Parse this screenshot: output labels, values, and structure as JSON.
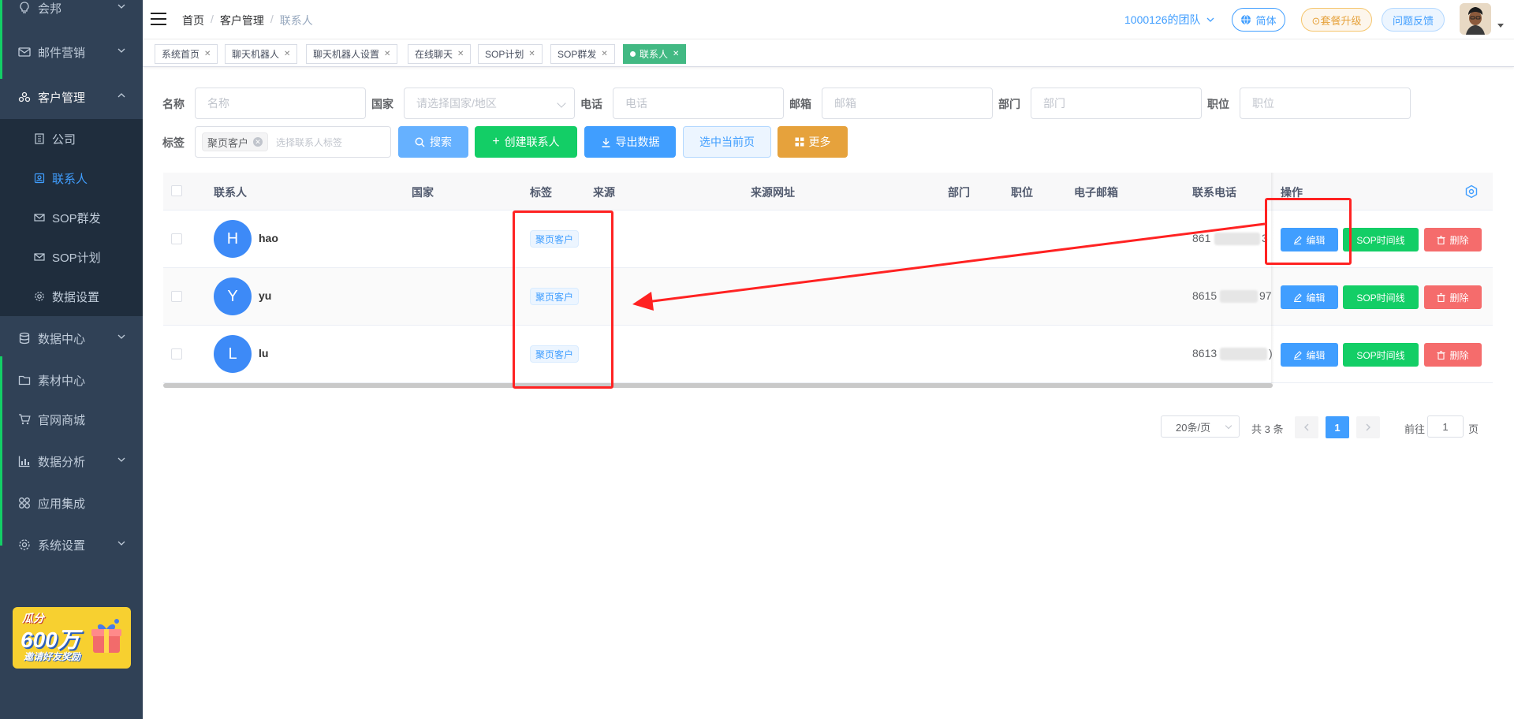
{
  "sidebar": {
    "top_item": "会邦",
    "items": [
      {
        "label": "邮件营销"
      },
      {
        "label": "客户管理"
      },
      {
        "label": "数据中心"
      },
      {
        "label": "素材中心"
      },
      {
        "label": "官网商城"
      },
      {
        "label": "数据分析"
      },
      {
        "label": "应用集成"
      },
      {
        "label": "系统设置"
      }
    ],
    "submenu": [
      {
        "label": "公司"
      },
      {
        "label": "联系人"
      },
      {
        "label": "SOP群发"
      },
      {
        "label": "SOP计划"
      },
      {
        "label": "数据设置"
      }
    ],
    "promo": {
      "line1": "瓜分",
      "line2": "600万",
      "line3": "邀请好友奖励"
    }
  },
  "header": {
    "breadcrumb": [
      "首页",
      "客户管理",
      "联系人"
    ],
    "team": "1000126的团队",
    "lang": "简体",
    "upgrade": "⊙套餐升级",
    "feedback": "问题反馈"
  },
  "tags": [
    {
      "label": "系统首页"
    },
    {
      "label": "聊天机器人"
    },
    {
      "label": "聊天机器人设置"
    },
    {
      "label": "在线聊天"
    },
    {
      "label": "SOP计划"
    },
    {
      "label": "SOP群发"
    },
    {
      "label": "联系人"
    }
  ],
  "filters": {
    "name_label": "名称",
    "name_placeholder": "名称",
    "country_label": "国家",
    "country_placeholder": "请选择国家/地区",
    "phone_label": "电话",
    "phone_placeholder": "电话",
    "email_label": "邮箱",
    "email_placeholder": "邮箱",
    "dept_label": "部门",
    "dept_placeholder": "部门",
    "position_label": "职位",
    "position_placeholder": "职位",
    "tag_label": "标签",
    "tag_chip": "聚页客户",
    "tag_placeholder": "选择联系人标签"
  },
  "buttons": {
    "search": "搜索",
    "create": "创建联系人",
    "export": "导出数据",
    "select_page": "选中当前页",
    "more": "更多"
  },
  "table": {
    "headers": [
      "联系人",
      "国家",
      "标签",
      "来源",
      "来源网址",
      "部门",
      "职位",
      "电子邮箱",
      "联系电话",
      "操作"
    ],
    "rows": [
      {
        "initial": "H",
        "name": "hao",
        "tag": "聚页客户",
        "phone_prefix": "861",
        "phone_suffix": "3"
      },
      {
        "initial": "Y",
        "name": "yu",
        "tag": "聚页客户",
        "phone_prefix": "8615",
        "phone_suffix": "97"
      },
      {
        "initial": "L",
        "name": "lu",
        "tag": "聚页客户",
        "phone_prefix": "8613",
        "phone_suffix": ")"
      }
    ],
    "actions": {
      "edit": "编辑",
      "sop": "SOP时间线",
      "delete": "删除"
    }
  },
  "pagination": {
    "page_size": "20条/页",
    "total": "共 3 条",
    "current_page": "1",
    "goto_label": "前往",
    "goto_value": "1",
    "page_unit": "页"
  },
  "colors": {
    "sidebar_bg": "#304156",
    "primary": "#409eff",
    "success": "#13ce66",
    "danger": "#f56c6c",
    "warning": "#e6a23c",
    "annotation": "#ff2222"
  }
}
